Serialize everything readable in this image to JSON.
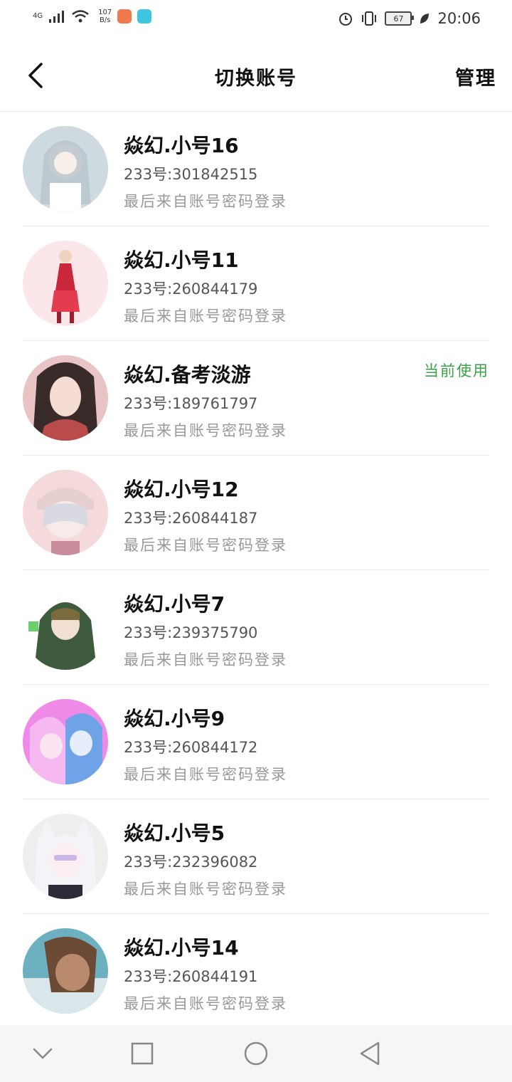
{
  "status_bar": {
    "network": "4G",
    "speed_value": "107",
    "speed_unit": "B/s",
    "battery": "67",
    "time": "20:06"
  },
  "header": {
    "title": "切换账号",
    "manage_label": "管理"
  },
  "accounts": [
    {
      "name": "焱幻.小号16",
      "uid_label": "233号:",
      "uid": "301842515",
      "login_method": "最后来自账号密码登录",
      "current": ""
    },
    {
      "name": "焱幻.小号11",
      "uid_label": "233号:",
      "uid": "260844179",
      "login_method": "最后来自账号密码登录",
      "current": ""
    },
    {
      "name": "焱幻.备考淡游",
      "uid_label": "233号:",
      "uid": "189761797",
      "login_method": "最后来自账号密码登录",
      "current": "当前使用"
    },
    {
      "name": "焱幻.小号12",
      "uid_label": "233号:",
      "uid": "260844187",
      "login_method": "最后来自账号密码登录",
      "current": ""
    },
    {
      "name": "焱幻.小号7",
      "uid_label": "233号:",
      "uid": "239375790",
      "login_method": "最后来自账号密码登录",
      "current": ""
    },
    {
      "name": "焱幻.小号9",
      "uid_label": "233号:",
      "uid": "260844172",
      "login_method": "最后来自账号密码登录",
      "current": ""
    },
    {
      "name": "焱幻.小号5",
      "uid_label": "233号:",
      "uid": "232396082",
      "login_method": "最后来自账号密码登录",
      "current": ""
    },
    {
      "name": "焱幻.小号14",
      "uid_label": "233号:",
      "uid": "260844191",
      "login_method": "最后来自账号密码登录",
      "current": ""
    }
  ],
  "colors": {
    "current_accent": "#3aa24a",
    "secondary_text": "#999999"
  }
}
